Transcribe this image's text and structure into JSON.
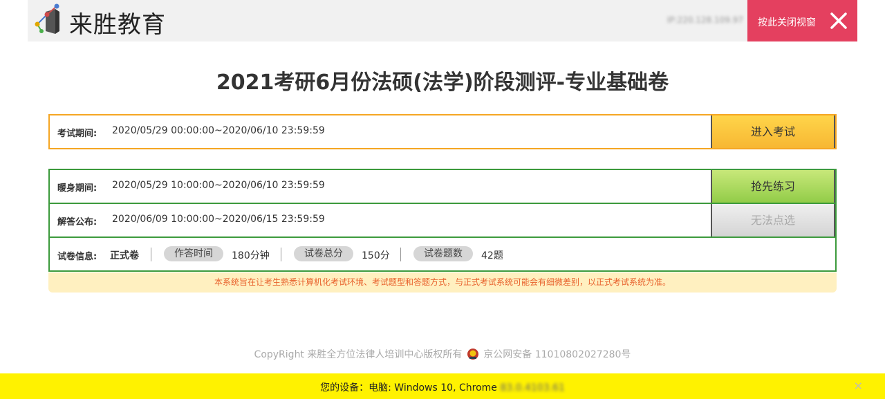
{
  "header": {
    "brand": "来胜教育",
    "ip": "IP:220.128.109.97",
    "close_label": "按此关闭视窗"
  },
  "title": "2021考研6月份法硕(法学)阶段测评-专业基础卷",
  "exam": {
    "label": "考试期间:",
    "value": "2020/05/29 00:00:00~2020/06/10 23:59:59",
    "button": "进入考试"
  },
  "warmup": {
    "label": "暖身期间:",
    "value": "2020/05/29 10:00:00~2020/06/10 23:59:59",
    "button": "抢先练习"
  },
  "answer": {
    "label": "解答公布:",
    "value": "2020/06/09 10:00:00~2020/06/15 23:59:59",
    "button": "无法点选"
  },
  "paper_info": {
    "label": "试卷信息:",
    "type": "正式卷",
    "time_label": "作答时间",
    "time_value": "180分钟",
    "score_label": "试卷总分",
    "score_value": "150分",
    "count_label": "试卷题数",
    "count_value": "42题"
  },
  "notice": "本系统旨在让考生熟悉计算机化考试环境、考试题型和答题方式，与正式考试系统可能会有细微差别，以正式考试系统为准。",
  "footer": {
    "copyright": "CopyRight 来胜全方位法律人培训中心版权所有",
    "icp": "京公网安备 11010802027280号"
  },
  "device_bar": {
    "prefix": "您的设备：电脑: Windows 10, Chrome",
    "version": "83.0.4103.61",
    "close": "×"
  },
  "colors": {
    "close_red": "#e4405f",
    "exam_orange": "#f5a623",
    "group_green": "#3c9a3c",
    "notice_text": "#e8612c",
    "device_bar": "#fff200"
  }
}
